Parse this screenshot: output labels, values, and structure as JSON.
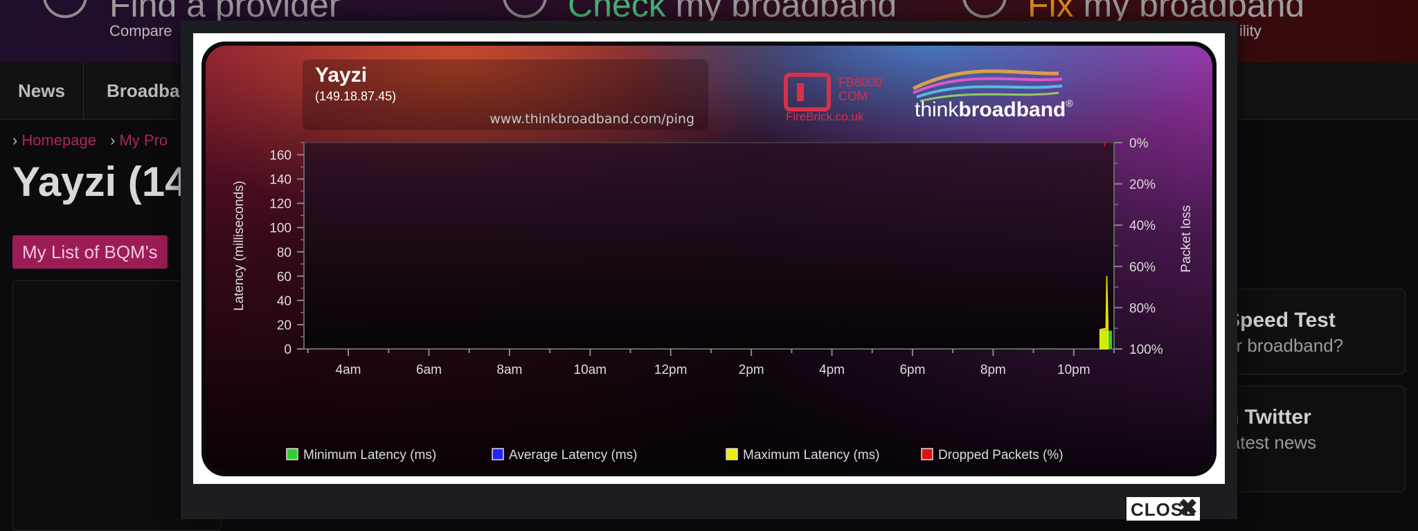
{
  "background_page": {
    "top": {
      "sections": [
        {
          "head_pre": "",
          "head_accent": "",
          "head_text": "Find a provider",
          "sub": "Compare"
        },
        {
          "head_pre": "",
          "head_accent": "Check",
          "head_text": " my broadband",
          "sub": ""
        },
        {
          "head_pre": "",
          "head_accent": "Fix",
          "head_text": " my broadband",
          "sub": "ility"
        }
      ]
    },
    "nav": [
      "News",
      "Broadba"
    ],
    "breadcrumb": [
      "Homepage",
      "My Pro"
    ],
    "page_title": "Yayzi (14",
    "list_button": "My List of BQM's",
    "side_cards": [
      {
        "title": "Speed Test",
        "sub": "ur broadband?"
      },
      {
        "title": "n Twitter",
        "sub": "latest news"
      }
    ]
  },
  "modal": {
    "close_label": "CLOSE",
    "graph": {
      "isp_name": "Yayzi",
      "ip": "(149.18.87.45)",
      "url": "www.thinkbroadband.com/ping",
      "sponsor_code": "FB6000",
      "sponsor_code2": "COM",
      "sponsor_site": "FireBrick.co.uk",
      "brand_think": "think",
      "brand_broadband": "broadband",
      "brand_reg": "®"
    }
  },
  "colors": {
    "min_latency": "#33cc33",
    "avg_latency": "#2222ff",
    "max_latency": "#eeee00",
    "dropped": "#dd1111"
  },
  "chart_data": {
    "type": "area",
    "title": "",
    "ylabel": "Latency (milliseconds)",
    "y2label": "Packet loss",
    "ylim": [
      0,
      170
    ],
    "y_ticks": [
      0,
      20,
      40,
      60,
      80,
      100,
      120,
      140,
      160
    ],
    "y2_ticks": [
      "0%",
      "20%",
      "40%",
      "60%",
      "80%",
      "100%"
    ],
    "x_labels": [
      "4am",
      "6am",
      "8am",
      "10am",
      "12pm",
      "2pm",
      "4pm",
      "6pm",
      "8pm",
      "10pm"
    ],
    "x_range_hours": [
      2.9,
      23.0
    ],
    "legend": [
      "Minimum Latency (ms)",
      "Average Latency (ms)",
      "Maximum Latency (ms)",
      "Dropped Packets (%)"
    ],
    "series": [
      {
        "name": "Minimum Latency (ms)",
        "points": [
          {
            "hour": 22.65,
            "value": 15
          },
          {
            "hour": 22.95,
            "value": 15
          }
        ]
      },
      {
        "name": "Average Latency (ms)",
        "points": []
      },
      {
        "name": "Maximum Latency (ms)",
        "points": [
          {
            "hour": 22.65,
            "value": 16
          },
          {
            "hour": 22.8,
            "value": 17
          },
          {
            "hour": 22.82,
            "value": 60
          },
          {
            "hour": 22.85,
            "value": 18
          }
        ]
      },
      {
        "name": "Dropped Packets (%)",
        "points": [
          {
            "hour": 22.75,
            "value": 0.5
          }
        ]
      }
    ]
  }
}
